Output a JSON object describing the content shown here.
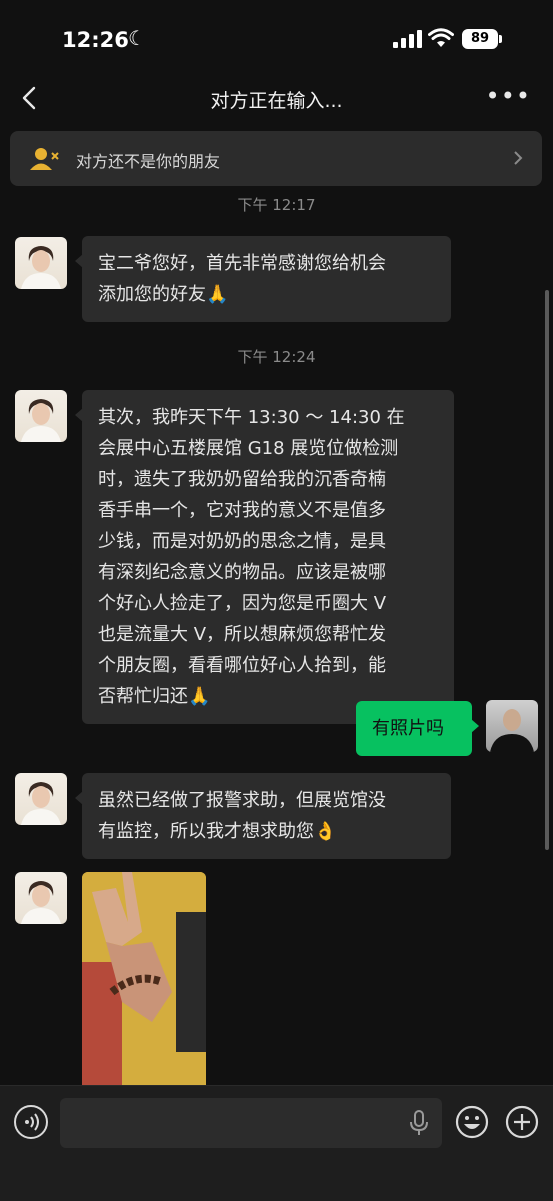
{
  "status_bar": {
    "time": "12:26",
    "battery": "89"
  },
  "nav": {
    "title": "对方正在输入..."
  },
  "banner": {
    "text": "对方还不是你的朋友"
  },
  "chat": {
    "timestamps": [
      "下午 12:17",
      "下午 12:24"
    ],
    "messages": [
      {
        "side": "in",
        "lines": [
          "宝二爷您好，首先非常感谢您给机会",
          "添加您的好友🙏"
        ]
      },
      {
        "side": "in",
        "lines": [
          "其次，我昨天下午 13:30 ～ 14:30 在",
          "会展中心五楼展馆 G18 展览位做检测",
          "时，遗失了我奶奶留给我的沉香奇楠",
          "香手串一个，它对我的意义不是值多",
          "少钱，而是对奶奶的思念之情，是具",
          "有深刻纪念意义的物品。应该是被哪",
          "个好心人捡走了，因为您是币圈大 V",
          "也是流量大 V，所以想麻烦您帮忙发",
          "个朋友圈，看看哪位好心人拾到，能",
          "否帮忙归还🙏"
        ]
      },
      {
        "side": "out",
        "lines": [
          "有照片吗"
        ]
      },
      {
        "side": "in",
        "lines": [
          "虽然已经做了报警求助，但展览馆没",
          "有监控，所以我才想求助您👌"
        ]
      }
    ]
  },
  "input": {
    "value": ""
  },
  "colors": {
    "background": "#111111",
    "bubble_in": "#2c2c2c",
    "bubble_out": "#07c160"
  },
  "icons": [
    "back-icon",
    "more-icon",
    "user-block-icon",
    "chevron-right-icon",
    "voice-icon",
    "mic-icon",
    "emoji-icon",
    "plus-icon"
  ]
}
